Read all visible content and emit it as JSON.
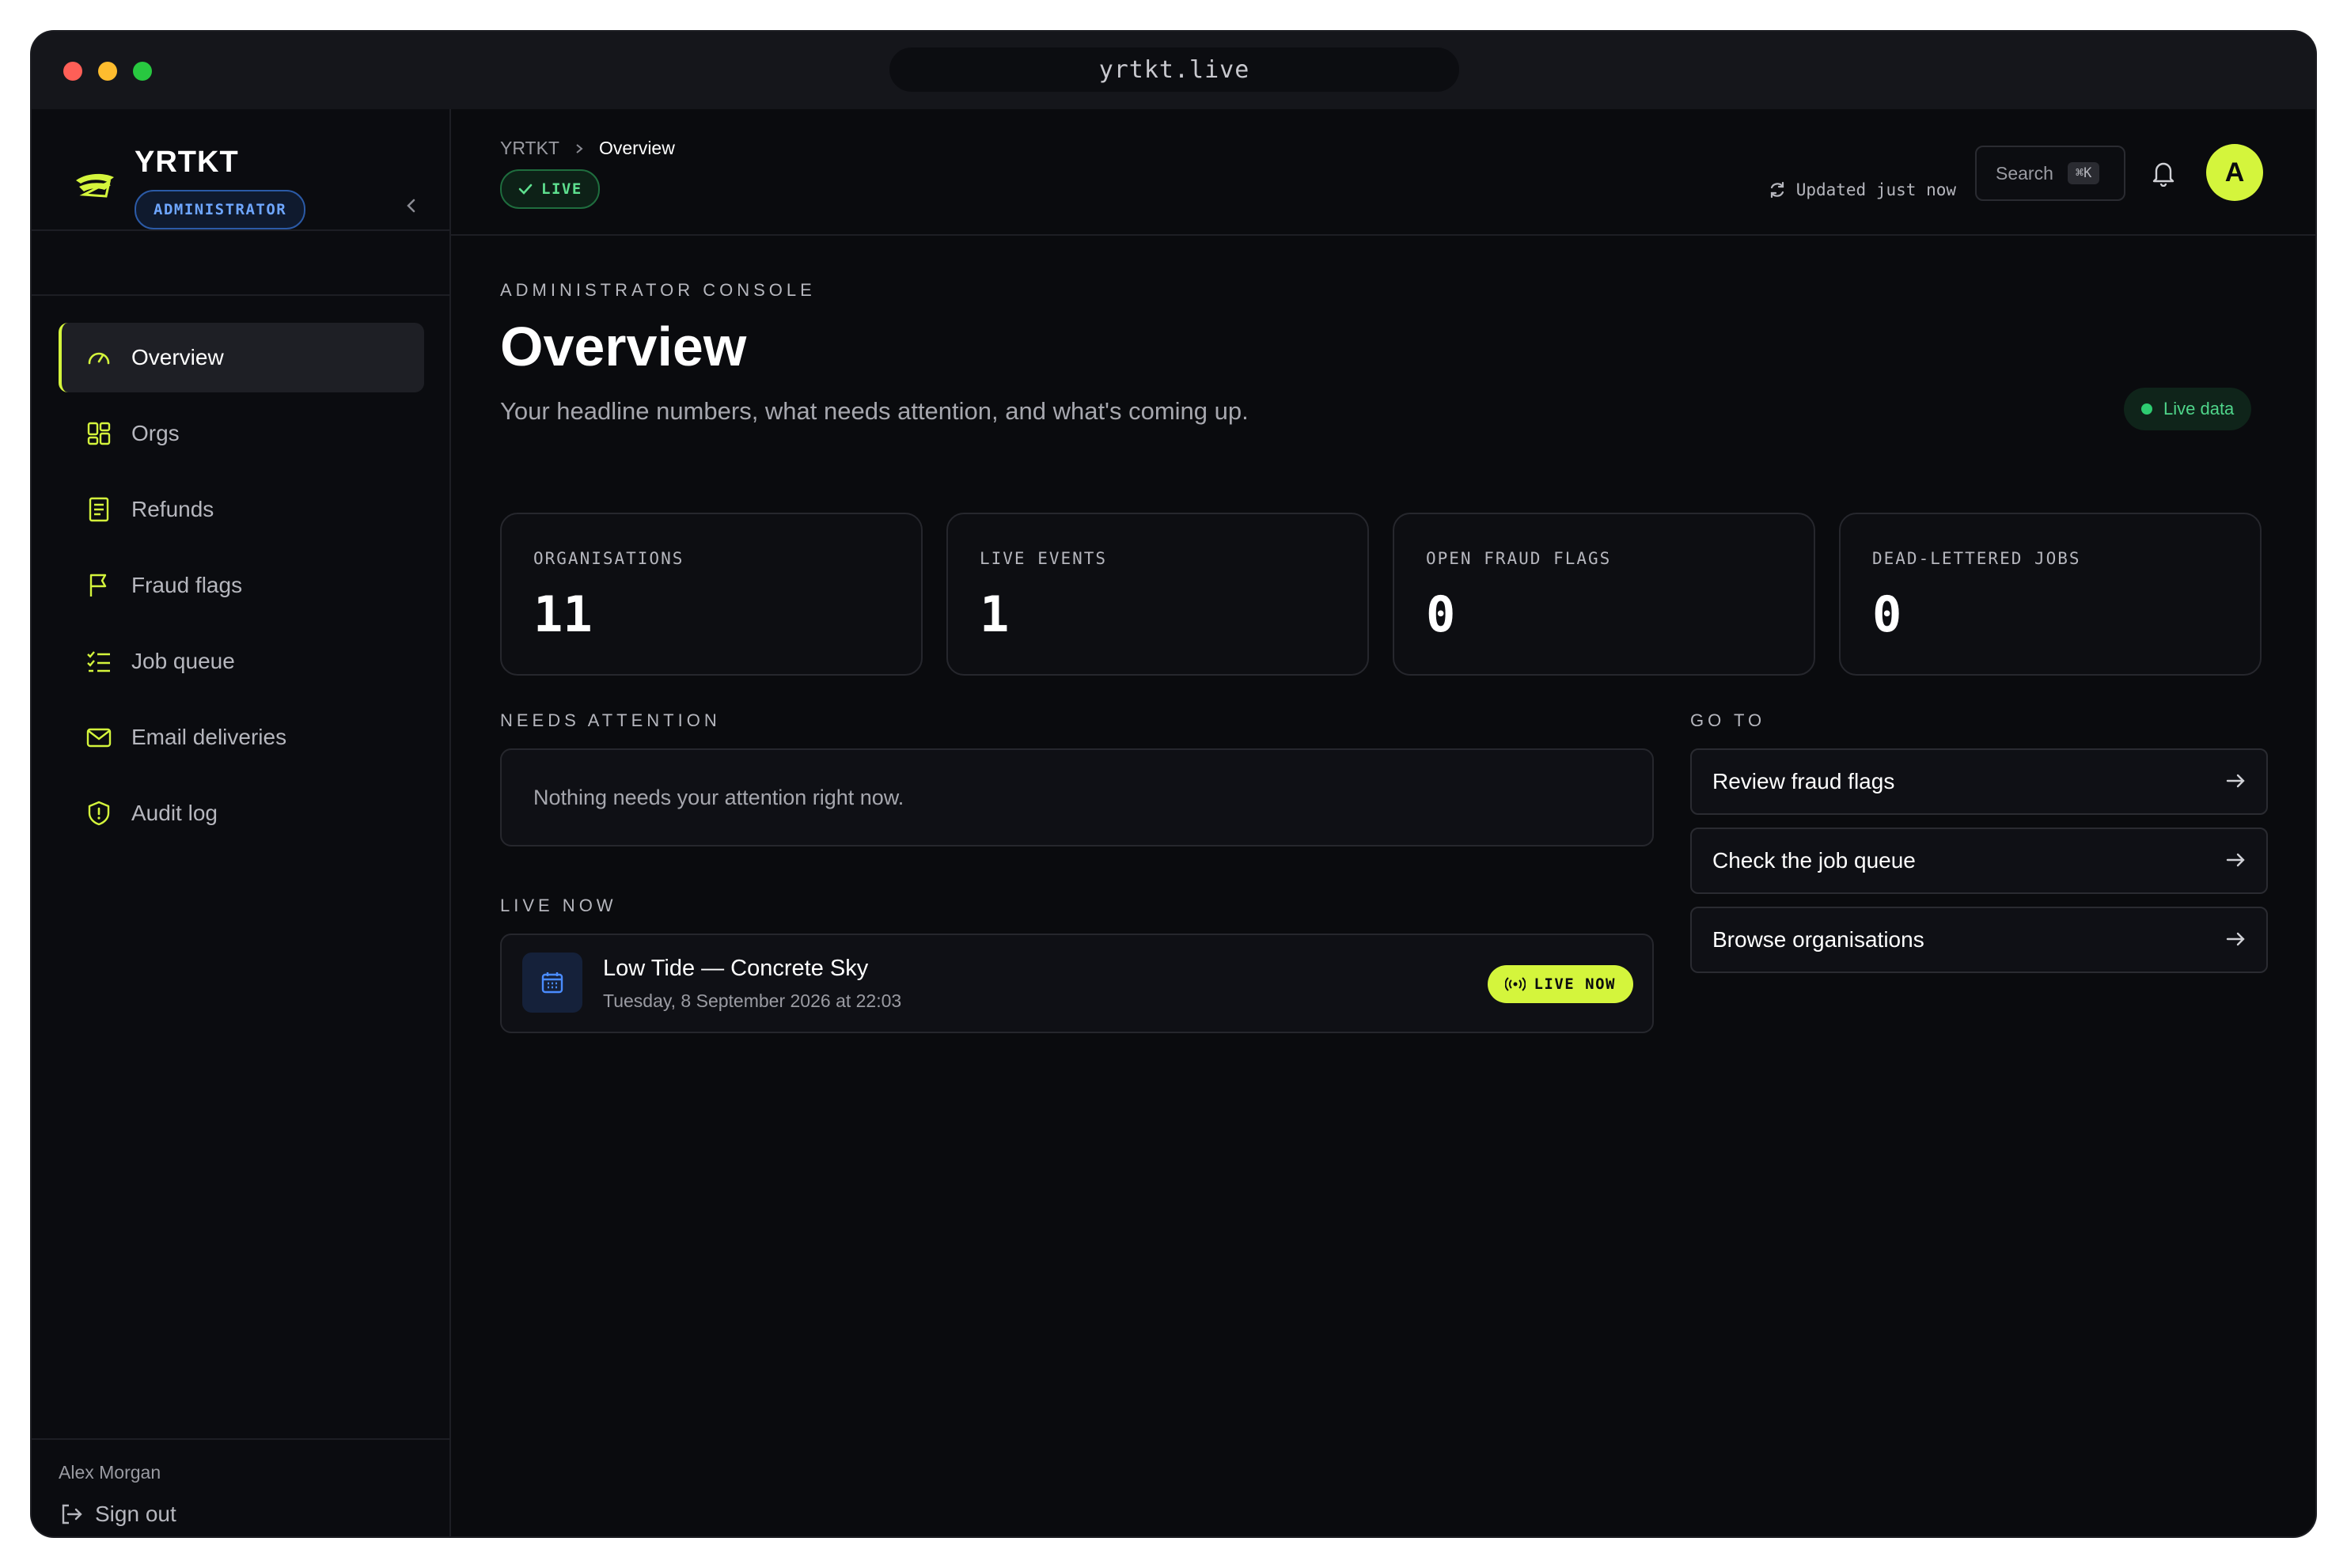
{
  "browser": {
    "url": "yrtkt.live"
  },
  "sidebar": {
    "brand": "YRTKT",
    "role": "ADMINISTRATOR",
    "items": [
      {
        "label": "Overview",
        "icon": "gauge-icon",
        "active": true
      },
      {
        "label": "Orgs",
        "icon": "grid-icon"
      },
      {
        "label": "Refunds",
        "icon": "receipt-icon"
      },
      {
        "label": "Fraud flags",
        "icon": "flag-icon"
      },
      {
        "label": "Job queue",
        "icon": "checklist-icon"
      },
      {
        "label": "Email deliveries",
        "icon": "mail-icon"
      },
      {
        "label": "Audit log",
        "icon": "shield-icon"
      }
    ],
    "user_name": "Alex Morgan",
    "sign_out": "Sign out"
  },
  "topbar": {
    "breadcrumb_root": "YRTKT",
    "breadcrumb_current": "Overview",
    "status": "LIVE",
    "updated": "Updated just now",
    "search_label": "Search",
    "search_shortcut": "⌘K",
    "avatar_initial": "A"
  },
  "page": {
    "eyebrow": "ADMINISTRATOR CONSOLE",
    "title": "Overview",
    "subtitle": "Your headline numbers, what needs attention, and what's coming up.",
    "live_data": "Live data"
  },
  "stats": [
    {
      "label": "ORGANISATIONS",
      "value": "11"
    },
    {
      "label": "LIVE EVENTS",
      "value": "1"
    },
    {
      "label": "OPEN FRAUD FLAGS",
      "value": "0"
    },
    {
      "label": "DEAD-LETTERED JOBS",
      "value": "0"
    }
  ],
  "needs_attention": {
    "heading": "NEEDS ATTENTION",
    "message": "Nothing needs your attention right now."
  },
  "live_now": {
    "heading": "LIVE NOW",
    "event_title": "Low Tide — Concrete Sky",
    "event_date": "Tuesday, 8 September 2026 at 22:03",
    "badge": "LIVE NOW"
  },
  "go_to": {
    "heading": "GO TO",
    "links": [
      "Review fraud flags",
      "Check the job queue",
      "Browse organisations"
    ]
  },
  "colors": {
    "accent": "#d4f53c",
    "background": "#0a0b0e",
    "live_green": "#5ee08f",
    "role_blue": "#6ea6ff"
  }
}
